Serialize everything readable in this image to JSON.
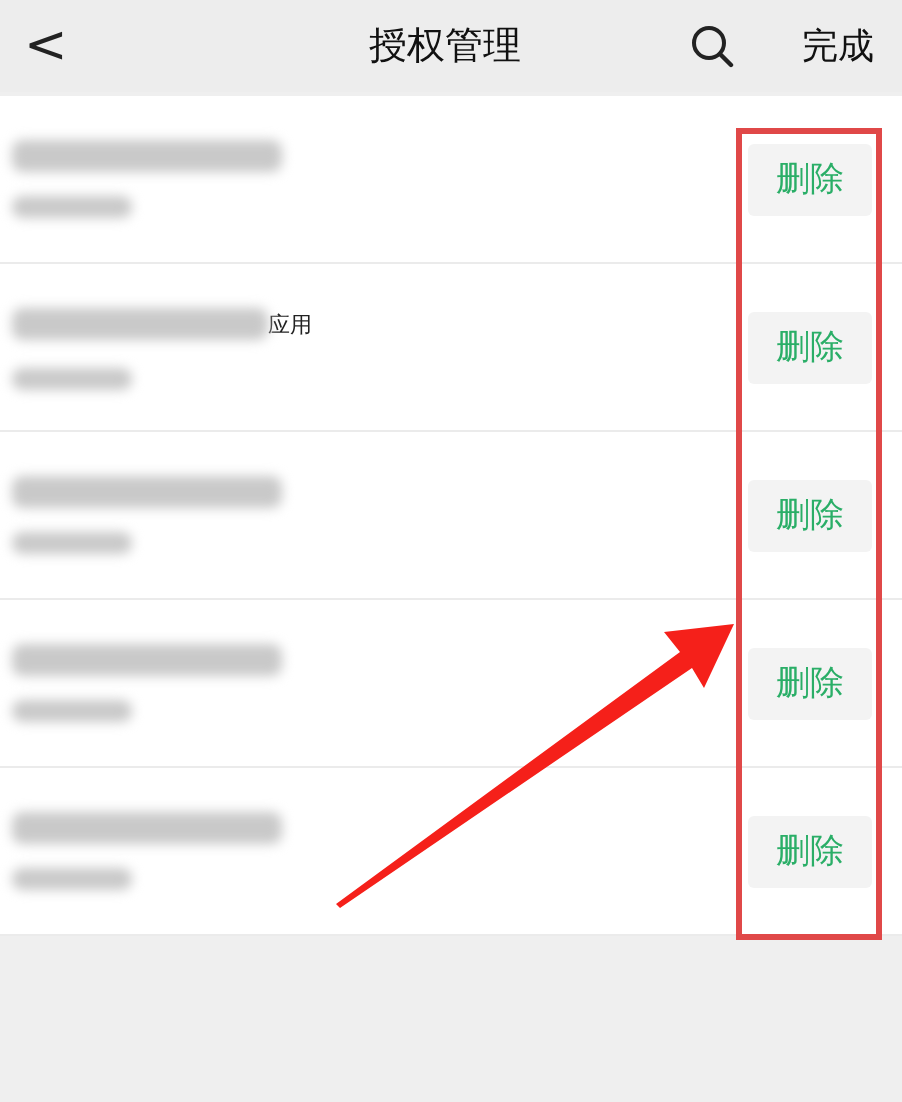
{
  "header": {
    "back": "<",
    "title": "授权管理",
    "done": "完成"
  },
  "rows": [
    {
      "action": "删除"
    },
    {
      "tag": "应用",
      "action": "删除"
    },
    {
      "action": "删除"
    },
    {
      "action": "删除"
    },
    {
      "action": "删除"
    }
  ]
}
